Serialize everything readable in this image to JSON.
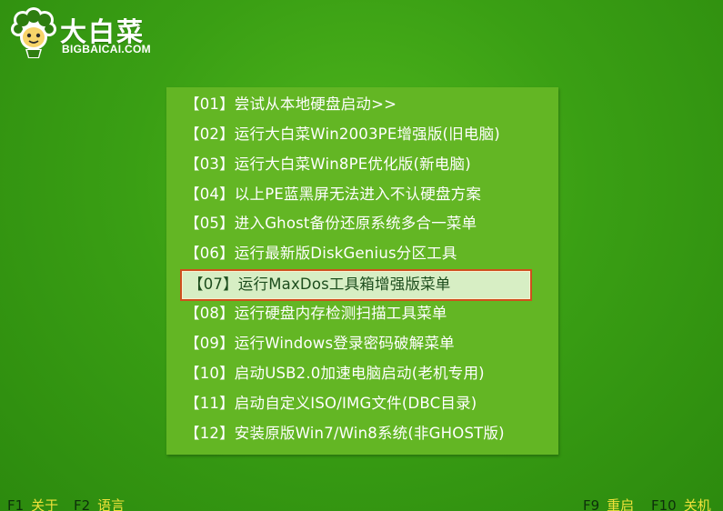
{
  "brand": {
    "title": "大白菜",
    "subtitle": "BIGBAICAI.COM",
    "mascot_icon": "cabbage-mascot-icon"
  },
  "menu": {
    "selected_index": 6,
    "items": [
      {
        "label": "【01】尝试从本地硬盘启动>>"
      },
      {
        "label": "【02】运行大白菜Win2003PE增强版(旧电脑)"
      },
      {
        "label": "【03】运行大白菜Win8PE优化版(新电脑)"
      },
      {
        "label": "【04】以上PE蓝黑屏无法进入不认硬盘方案"
      },
      {
        "label": "【05】进入Ghost备份还原系统多合一菜单"
      },
      {
        "label": "【06】运行最新版DiskGenius分区工具"
      },
      {
        "label": "【07】运行MaxDos工具箱增强版菜单"
      },
      {
        "label": "【08】运行硬盘内存检测扫描工具菜单"
      },
      {
        "label": "【09】运行Windows登录密码破解菜单"
      },
      {
        "label": "【10】启动USB2.0加速电脑启动(老机专用)"
      },
      {
        "label": "【11】启动自定义ISO/IMG文件(DBC目录)"
      },
      {
        "label": "【12】安装原版Win7/Win8系统(非GHOST版)"
      }
    ]
  },
  "footer": {
    "keys": [
      {
        "key": "F1",
        "action": "关于"
      },
      {
        "key": "F2",
        "action": "语言"
      },
      {
        "key": "F9",
        "action": "重启"
      },
      {
        "key": "F10",
        "action": "关机"
      }
    ]
  },
  "colors": {
    "background": "#3a9f14",
    "panel": "#63b624",
    "highlight_bg": "#d7eec4",
    "highlight_border": "#cf4f1e",
    "footer_action": "#f0e23a"
  }
}
